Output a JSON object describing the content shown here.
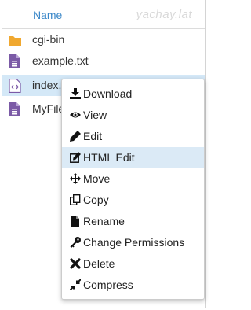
{
  "header": {
    "name_label": "Name",
    "watermark": "yachay.lat"
  },
  "files": [
    {
      "name": "cgi-bin",
      "icon": "folder-icon",
      "selected": false
    },
    {
      "name": "example.txt",
      "icon": "file-text-icon",
      "selected": false
    },
    {
      "name": "index.",
      "icon": "file-code-icon",
      "selected": true
    },
    {
      "name": "MyFile",
      "icon": "file-text-icon",
      "selected": false
    }
  ],
  "context_menu": {
    "items": [
      {
        "label": "Download",
        "icon": "download-icon"
      },
      {
        "label": "View",
        "icon": "eye-icon"
      },
      {
        "label": "Edit",
        "icon": "pencil-icon"
      },
      {
        "label": "HTML Edit",
        "icon": "edit-square-icon",
        "highlighted": true
      },
      {
        "label": "Move",
        "icon": "move-arrows-icon"
      },
      {
        "label": "Copy",
        "icon": "copy-icon"
      },
      {
        "label": "Rename",
        "icon": "file-icon"
      },
      {
        "label": "Change Permissions",
        "icon": "key-icon"
      },
      {
        "label": "Delete",
        "icon": "x-icon"
      },
      {
        "label": "Compress",
        "icon": "compress-icon"
      }
    ]
  },
  "colors": {
    "accent": "#3a87c8",
    "folder": "#f0a830",
    "file": "#7b5aa6",
    "hover": "#dbeaf6"
  }
}
